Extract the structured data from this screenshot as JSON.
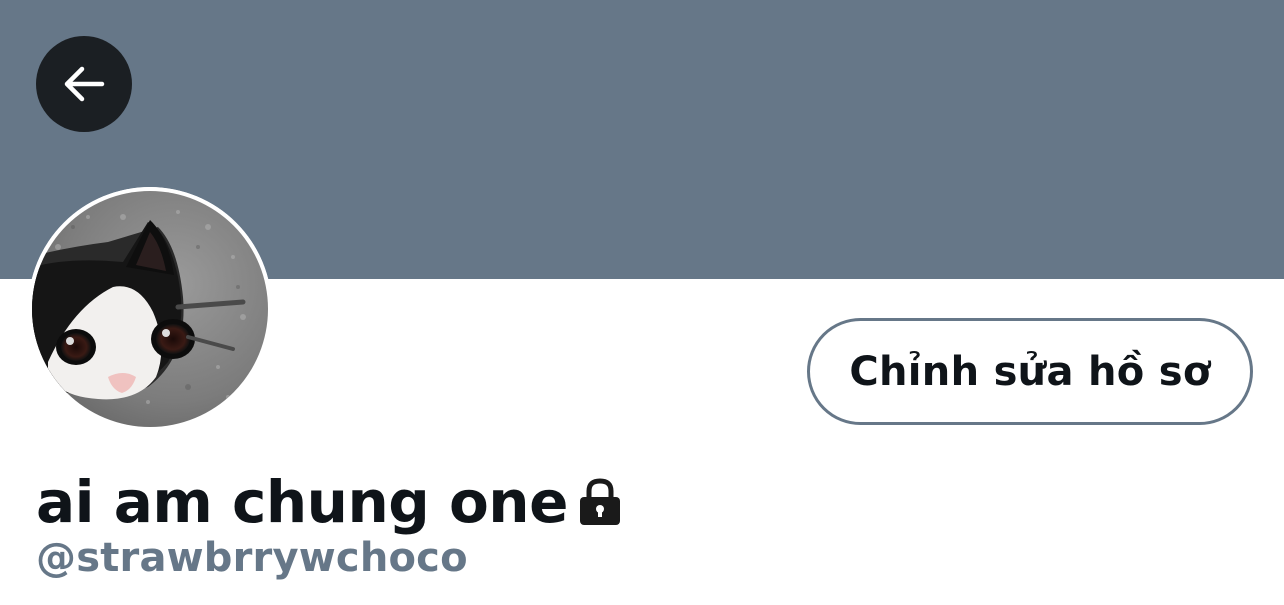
{
  "header": {
    "banner_color": "#667788",
    "back_button_icon": "arrow-left-icon"
  },
  "profile": {
    "avatar_description_icon": "cat-avatar-image",
    "edit_profile_label": "Chỉnh sửa hồ sơ",
    "display_name": "ai am chung one",
    "protected_icon": "lock-icon",
    "handle": "@strawbrrywchoco"
  },
  "colors": {
    "text_primary": "#0f1419",
    "text_secondary": "#667788",
    "button_border": "#667788",
    "back_button_bg": "#1b1f23"
  }
}
